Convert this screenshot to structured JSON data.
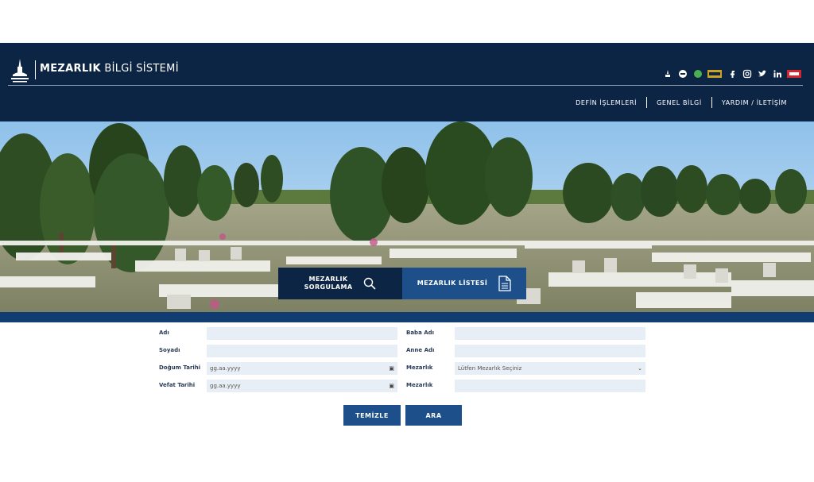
{
  "brand": {
    "title_bold": "MEZARLIK",
    "title_light": " BİLGİ SİSTEMİ"
  },
  "socials": [
    "ambulance-icon",
    "chat-icon",
    "whatsapp-icon",
    "badge-icon",
    "facebook-icon",
    "instagram-icon",
    "twitter-icon",
    "linkedin-icon",
    "brand-logo-icon"
  ],
  "nav": {
    "items": [
      "DEFİN İŞLEMLERİ",
      "GENEL BİLGİ",
      "YARDIM / İLETİŞİM"
    ]
  },
  "actions": {
    "query_line1": "MEZARLIK",
    "query_line2": "SORGULAMA",
    "list_label": "MEZARLIK LİSTESİ"
  },
  "form": {
    "ad_label": "Adı",
    "soyad_label": "Soyadı",
    "dogum_label": "Doğum Tarihi",
    "vefat_label": "Vefat Tarihi",
    "baba_label": "Baba Adı",
    "anne_label": "Anne Adı",
    "mezarlik_label": "Mezarlık",
    "mezarlik_value": "Lütfen Mezarlık Seçiniz",
    "mezarlik2_label": "Mezarlık",
    "dogum_placeholder": "gg.aa.yyyy",
    "vefat_placeholder": "gg.aa.yyyy"
  },
  "buttons": {
    "clear": "TEMİZLE",
    "search": "ARA"
  },
  "colors": {
    "header_bg": "#0d2545",
    "accent_blue": "#1d4f8a",
    "field_bg": "#e8eef5"
  }
}
